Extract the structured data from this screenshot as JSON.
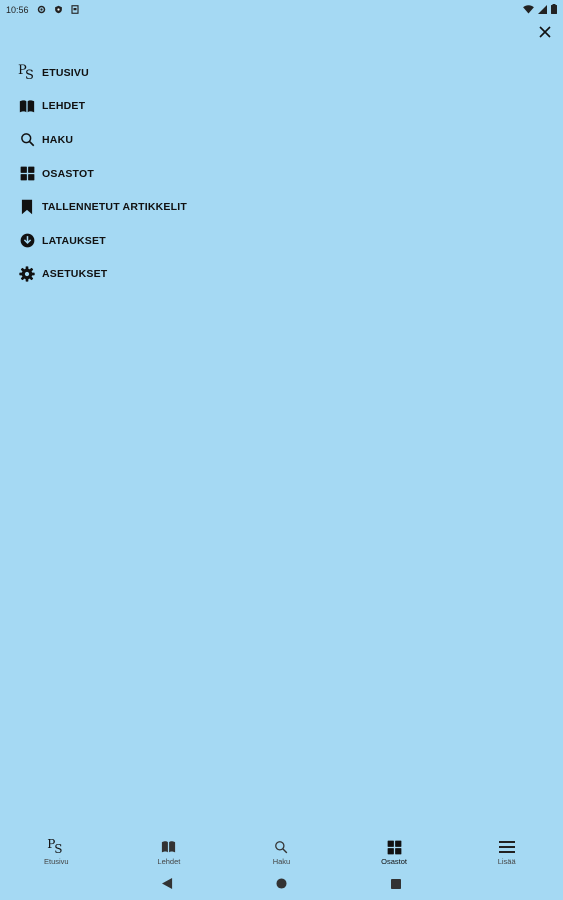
{
  "status_bar": {
    "time": "10:56"
  },
  "drawer": {
    "items": [
      {
        "label": "ETUSIVU",
        "icon": "ps-logo-icon"
      },
      {
        "label": "LEHDET",
        "icon": "book-open-icon"
      },
      {
        "label": "HAKU",
        "icon": "search-icon"
      },
      {
        "label": "OSASTOT",
        "icon": "grid-icon"
      },
      {
        "label": "TALLENNETUT ARTIKKELIT",
        "icon": "bookmark-icon"
      },
      {
        "label": "LATAUKSET",
        "icon": "download-icon"
      },
      {
        "label": "ASETUKSET",
        "icon": "gear-icon"
      }
    ]
  },
  "bottom_nav": {
    "items": [
      {
        "label": "Etusivu",
        "icon": "ps-logo-icon"
      },
      {
        "label": "Lehdet",
        "icon": "book-open-icon"
      },
      {
        "label": "Haku",
        "icon": "search-icon"
      },
      {
        "label": "Osastot",
        "icon": "grid-icon",
        "active": true
      },
      {
        "label": "Lisää",
        "icon": "menu-icon"
      }
    ]
  },
  "colors": {
    "background": "#a5d9f3",
    "text": "#111111"
  }
}
